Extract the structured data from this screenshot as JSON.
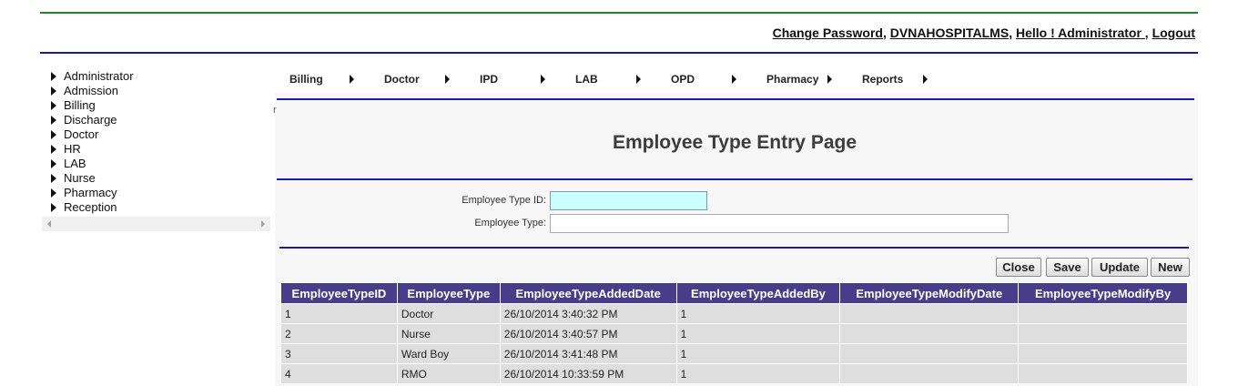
{
  "header": {
    "change_password": "Change Password",
    "org": "DVNAHOSPITALMS",
    "greeting": "Hello ! Administrator ",
    "logout": "Logout"
  },
  "sidebar": {
    "items": [
      "Administrator",
      "Admission",
      "Billing",
      "Discharge",
      "Doctor",
      "HR",
      "LAB",
      "Nurse",
      "Pharmacy",
      "Reception"
    ]
  },
  "menu": {
    "items": [
      "Billing",
      "Doctor",
      "IPD",
      "LAB",
      "OPD",
      "Pharmacy",
      "Reports"
    ]
  },
  "stray_text": "r",
  "page": {
    "title": "Employee Type Entry Page"
  },
  "form": {
    "type_id_label": "Employee Type ID:",
    "type_id_value": "",
    "type_label": "Employee Type:",
    "type_value": ""
  },
  "buttons": {
    "close": "Close",
    "save": "Save",
    "update": "Update",
    "new": "New"
  },
  "grid": {
    "columns": [
      "EmployeeTypeID",
      "EmployeeType",
      "EmployeeTypeAddedDate",
      "EmployeeTypeAddedBy",
      "EmployeeTypeModifyDate",
      "EmployeeTypeModifyBy"
    ],
    "rows": [
      [
        "1",
        "Doctor",
        "26/10/2014 3:40:32 PM",
        "1",
        "",
        ""
      ],
      [
        "2",
        "Nurse",
        "26/10/2014 3:40:57 PM",
        "1",
        "",
        ""
      ],
      [
        "3",
        "Ward Boy",
        "26/10/2014 3:41:48 PM",
        "1",
        "",
        ""
      ],
      [
        "4",
        "RMO",
        "26/10/2014 10:33:59 PM",
        "1",
        "",
        ""
      ]
    ]
  },
  "colors": {
    "header_green": "#2e7d32",
    "divider_blue": "#1a1aa8",
    "grid_header": "#483d8b",
    "grid_cell": "#dedede",
    "focused_input": "#ccffff"
  }
}
